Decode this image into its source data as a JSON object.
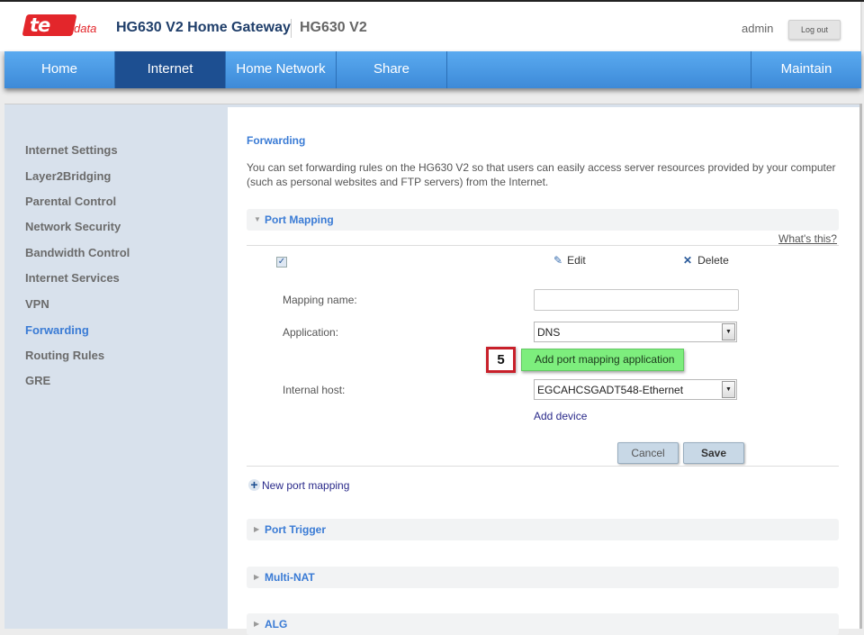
{
  "header": {
    "logo_mark": "te",
    "logo_sub": "data",
    "title": "HG630 V2 Home Gateway",
    "model": "HG630 V2",
    "user": "admin",
    "logout_label": "Log out"
  },
  "nav": {
    "items": [
      {
        "label": "Home"
      },
      {
        "label": "Internet",
        "active": true
      },
      {
        "label": "Home Network"
      },
      {
        "label": "Share"
      },
      {
        "label": "Maintain"
      }
    ]
  },
  "sidebar": {
    "items": [
      {
        "label": "Internet Settings"
      },
      {
        "label": "Layer2Bridging"
      },
      {
        "label": "Parental Control"
      },
      {
        "label": "Network Security"
      },
      {
        "label": "Bandwidth Control"
      },
      {
        "label": "Internet Services"
      },
      {
        "label": "VPN"
      },
      {
        "label": "Forwarding",
        "active": true
      },
      {
        "label": "Routing Rules"
      },
      {
        "label": "GRE"
      }
    ]
  },
  "content": {
    "title": "Forwarding",
    "description": "You can set forwarding rules on the HG630 V2 so that users can easily access server resources provided by your computer (such as personal websites and FTP servers) from the Internet.",
    "whats_this": "What's this?",
    "sections": {
      "port_mapping": "Port Mapping",
      "port_trigger": "Port Trigger",
      "multi_nat": "Multi-NAT",
      "alg": "ALG"
    },
    "row": {
      "checkbox_checked": true,
      "edit_label": "Edit",
      "delete_label": "Delete"
    },
    "form": {
      "mapping_name_label": "Mapping name:",
      "mapping_name_value": "",
      "application_label": "Application:",
      "application_value": "DNS",
      "add_app_label": "Add port mapping application",
      "step_number": "5",
      "internal_host_label": "Internal host:",
      "internal_host_value": "EGCAHCSGADT548-Ethernet",
      "add_device_label": "Add device",
      "cancel_label": "Cancel",
      "save_label": "Save"
    },
    "new_mapping_label": "New port mapping"
  },
  "icons": {
    "edit": "✎",
    "delete": "✕",
    "plus": "+",
    "check": "✓",
    "dropdown": "▼",
    "expanded": "▼",
    "collapsed": "▶"
  },
  "colors": {
    "accent": "#3a7bd5",
    "nav_active": "#1d4f91",
    "brand_red": "#e3262b",
    "highlight_green": "#7dee7d"
  }
}
